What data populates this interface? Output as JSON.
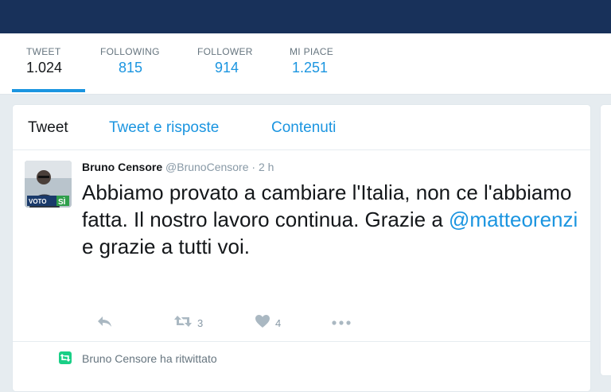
{
  "profile_stats": [
    {
      "label": "TWEET",
      "value": "1.024"
    },
    {
      "label": "FOLLOWING",
      "value": "815"
    },
    {
      "label": "FOLLOWER",
      "value": "914"
    },
    {
      "label": "MI PIACE",
      "value": "1.251"
    }
  ],
  "tabs": [
    "Tweet",
    "Tweet e risposte",
    "Contenuti"
  ],
  "tweet": {
    "author_name": "Bruno Censore",
    "author_handle": "@BrunoCensore",
    "separator": "·",
    "time": "2 h",
    "avatar_badge_text": "VOTO",
    "avatar_badge_si": "SÌ",
    "text_before_mention": "Abbiamo provato a cambiare l'Italia, non ce l'abbiamo fatta. Il nostro lavoro continua. Grazie a ",
    "mention": "@matteorenzi",
    "text_after_mention": " e grazie a tutti voi.",
    "actions": {
      "reply_icon": "reply-icon",
      "retweet_icon": "retweet-icon",
      "retweet_count": "3",
      "like_icon": "heart-icon",
      "like_count": "4",
      "more_icon": "more-dots-icon"
    }
  },
  "retweet_banner": {
    "icon": "retweet-icon",
    "text": "Bruno Censore ha ritwittato"
  },
  "colors": {
    "topbar": "#18315a",
    "accent": "#1b95e0",
    "retweet_green": "#19cf86",
    "muted": "#8899a6"
  }
}
